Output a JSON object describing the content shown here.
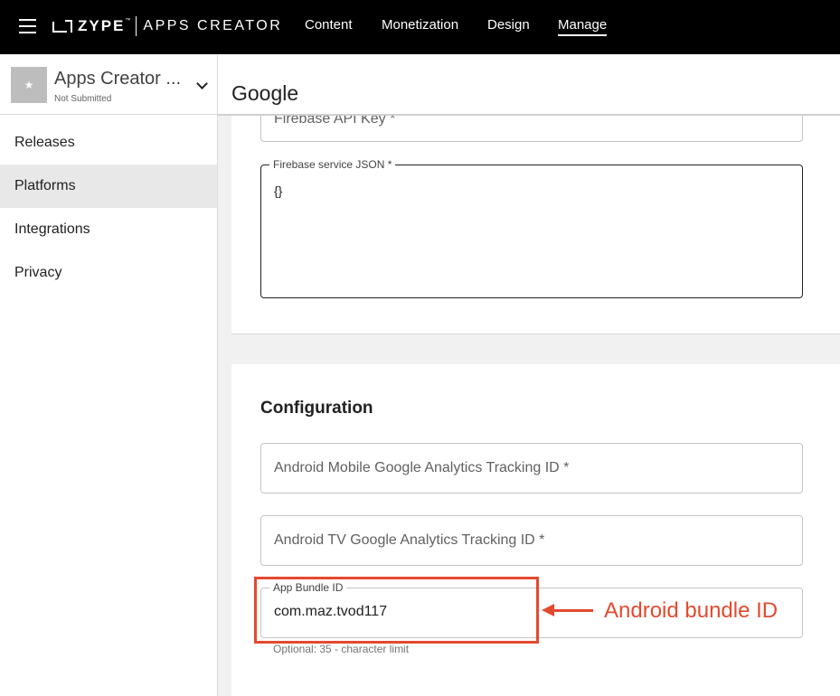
{
  "topbar": {
    "logo_brand": "ZYPE",
    "logo_tm": "™",
    "logo_product": "APPS CREATOR",
    "nav": [
      {
        "label": "Content"
      },
      {
        "label": "Monetization"
      },
      {
        "label": "Design"
      },
      {
        "label": "Manage",
        "active": true
      }
    ]
  },
  "sidebar": {
    "app_name": "Apps Creator ...",
    "app_status": "Not Submitted",
    "thumb_glyph": "★",
    "items": [
      {
        "label": "Releases"
      },
      {
        "label": "Platforms",
        "active": true
      },
      {
        "label": "Integrations"
      },
      {
        "label": "Privacy"
      }
    ]
  },
  "page": {
    "title": "Google"
  },
  "firebase": {
    "api_key_label": "Firebase API Key *",
    "service_json_label": "Firebase service JSON *",
    "service_json_value": "{}"
  },
  "configuration": {
    "title": "Configuration",
    "mobile_tracking_placeholder": "Android Mobile Google Analytics Tracking ID *",
    "tv_tracking_placeholder": "Android TV Google Analytics Tracking ID *",
    "bundle_id_label": "App Bundle ID",
    "bundle_id_value": "com.maz.tvod117",
    "bundle_id_helper": "Optional: 35 - character limit"
  },
  "annotation": {
    "label": "Android bundle ID",
    "color": "#e34a2f"
  }
}
